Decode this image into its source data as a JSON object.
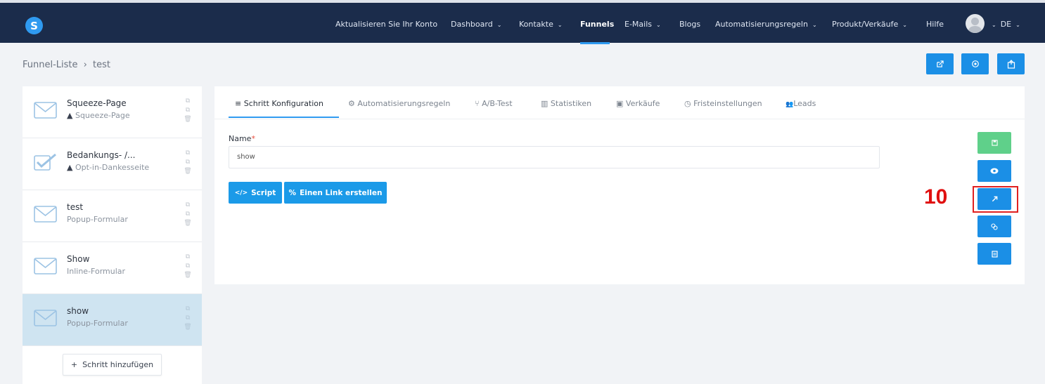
{
  "nav": {
    "logo": "S",
    "items": [
      {
        "label": "Aktualisieren Sie Ihr Konto",
        "dropdown": false,
        "active": false
      },
      {
        "label": "Dashboard",
        "dropdown": true,
        "active": false
      },
      {
        "label": "Kontakte",
        "dropdown": true,
        "active": false
      },
      {
        "label": "Funnels",
        "dropdown": false,
        "active": true
      },
      {
        "label": "E-Mails",
        "dropdown": true,
        "active": false
      },
      {
        "label": "Blogs",
        "dropdown": false,
        "active": false
      },
      {
        "label": "Automatisierungsregeln",
        "dropdown": true,
        "active": false
      },
      {
        "label": "Produkt/Verkäufe",
        "dropdown": true,
        "active": false
      },
      {
        "label": "Hilfe",
        "dropdown": false,
        "active": false
      }
    ],
    "language": "DE",
    "colors": {
      "bar": "#1b2c4b",
      "accent": "#2f9af0"
    }
  },
  "breadcrumb": {
    "parent": "Funnel-Liste",
    "separator": "›",
    "current": "test"
  },
  "header_buttons": [
    {
      "icon": "external-link-icon"
    },
    {
      "icon": "settings-icon"
    },
    {
      "icon": "export-icon"
    }
  ],
  "sidebar": {
    "steps": [
      {
        "title": "Squeeze-Page",
        "subtitle": "Squeeze-Page",
        "warning": true,
        "icon": "envelope-icon",
        "selected": false
      },
      {
        "title": "Bedankungs- /...",
        "subtitle": "Opt-in-Dankesseite",
        "warning": true,
        "icon": "checkbox-icon",
        "selected": false
      },
      {
        "title": "test",
        "subtitle": "Popup-Formular",
        "warning": false,
        "icon": "envelope-icon",
        "selected": false
      },
      {
        "title": "Show",
        "subtitle": "Inline-Formular",
        "warning": false,
        "icon": "envelope-icon",
        "selected": false
      },
      {
        "title": "show",
        "subtitle": "Popup-Formular",
        "warning": false,
        "icon": "envelope-icon",
        "selected": true
      }
    ],
    "add_step_label": "Schritt hinzufügen"
  },
  "tabs": [
    {
      "label": "Schritt Konfiguration",
      "icon": "≡",
      "active": true
    },
    {
      "label": "Automatisierungsregeln",
      "icon": "⚙",
      "active": false
    },
    {
      "label": "A/B-Test",
      "icon": "⑂",
      "active": false
    },
    {
      "label": "Statistiken",
      "icon": "▥",
      "active": false
    },
    {
      "label": "Verkäufe",
      "icon": "▣",
      "active": false
    },
    {
      "label": "Fristeinstellungen",
      "icon": "◷",
      "active": false
    },
    {
      "label": "Leads",
      "icon": "👥",
      "active": false
    }
  ],
  "form": {
    "name_label": "Name",
    "required_mark": "*",
    "name_value": "show",
    "script_button": "Script",
    "link_button": "Einen Link erstellen"
  },
  "side_actions": [
    {
      "icon": "save-icon",
      "color": "green"
    },
    {
      "icon": "eye-icon",
      "color": "blue"
    },
    {
      "icon": "edit-arrow-icon",
      "color": "blue"
    },
    {
      "icon": "copy-icon",
      "color": "blue"
    },
    {
      "icon": "document-icon",
      "color": "blue"
    }
  ],
  "annotation": {
    "number": "10",
    "color": "#e02020"
  }
}
